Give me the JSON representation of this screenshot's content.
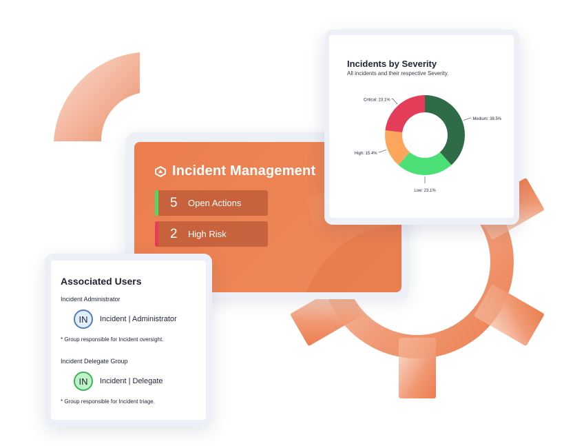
{
  "incident_card": {
    "title": "Incident Management",
    "stats": [
      {
        "count": "5",
        "label": "Open Actions",
        "accent": "#4cd964"
      },
      {
        "count": "2",
        "label": "High Risk",
        "accent": "#e63d5a"
      }
    ]
  },
  "severity_card": {
    "title": "Incidents by Severity",
    "subtitle": "All incidents and their respective Severity."
  },
  "chart_data": {
    "type": "pie",
    "title": "Incidents by Severity",
    "subtitle": "All incidents and their respective Severity.",
    "donut": true,
    "slices": [
      {
        "name": "Medium",
        "value": 38.5,
        "label": "Medium: 38.5%",
        "color": "#2e6b46"
      },
      {
        "name": "Low",
        "value": 23.1,
        "label": "Low: 23.1%",
        "color": "#4cdf78"
      },
      {
        "name": "High",
        "value": 15.4,
        "label": "High: 15.4%",
        "color": "#fca65d"
      },
      {
        "name": "Critical",
        "value": 23.1,
        "label": "Critical: 23.1%",
        "color": "#e33d5a"
      }
    ]
  },
  "users_card": {
    "title": "Associated Users",
    "groups": [
      {
        "name": "Incident Administrator",
        "avatar": "IN",
        "user": "Incident | Administrator",
        "note": "* Group responsible for Incident oversight."
      },
      {
        "name": "Incident Delegate Group",
        "avatar": "IN",
        "user": "Incident | Delegate",
        "note": "* Group responsible for Incident triage."
      }
    ]
  },
  "colors": {
    "brand_orange": "#ec7d4d",
    "dark_text": "#1d2333"
  },
  "icons": {
    "brand": "incident-logo-icon",
    "decor_left": "gear-fragment",
    "decor_right": "gear"
  }
}
